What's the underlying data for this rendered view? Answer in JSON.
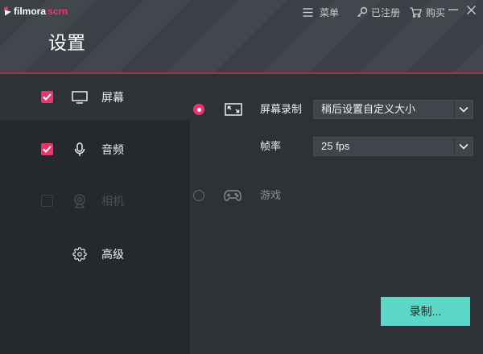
{
  "app": {
    "brand": "filmora",
    "brand_suffix": "scrn",
    "title": "设置"
  },
  "titlebar": {
    "menu": {
      "label": "菜单",
      "icon": "hamburger-icon"
    },
    "register": {
      "label": "已注册",
      "icon": "key-icon"
    },
    "buy": {
      "label": "购买",
      "icon": "cart-icon"
    },
    "minimize_icon": "minimize-icon",
    "close_icon": "close-icon"
  },
  "sidebar": {
    "items": [
      {
        "label": "屏幕",
        "icon": "monitor-icon",
        "checked": true,
        "selected": true,
        "enabled": true
      },
      {
        "label": "音频",
        "icon": "microphone-icon",
        "checked": true,
        "selected": false,
        "enabled": true
      },
      {
        "label": "相机",
        "icon": "webcam-icon",
        "checked": false,
        "selected": false,
        "enabled": false
      },
      {
        "label": "高级",
        "icon": "gear-icon",
        "selected": false,
        "enabled": true
      }
    ]
  },
  "screen_panel": {
    "screen_record": {
      "label": "屏幕录制",
      "icon": "fullscreen-icon",
      "selected": true,
      "dropdown_value": "稍后设置自定义大小"
    },
    "frame_rate": {
      "label": "帧率",
      "dropdown_value": "25 fps"
    },
    "game": {
      "label": "游戏",
      "icon": "gamepad-icon",
      "selected": false
    }
  },
  "record_button": {
    "label": "录制..."
  },
  "colors": {
    "accent": "#e8386b",
    "record_button": "#5bd7c7",
    "background": "#2e3135",
    "sidebar": "#26292c"
  }
}
